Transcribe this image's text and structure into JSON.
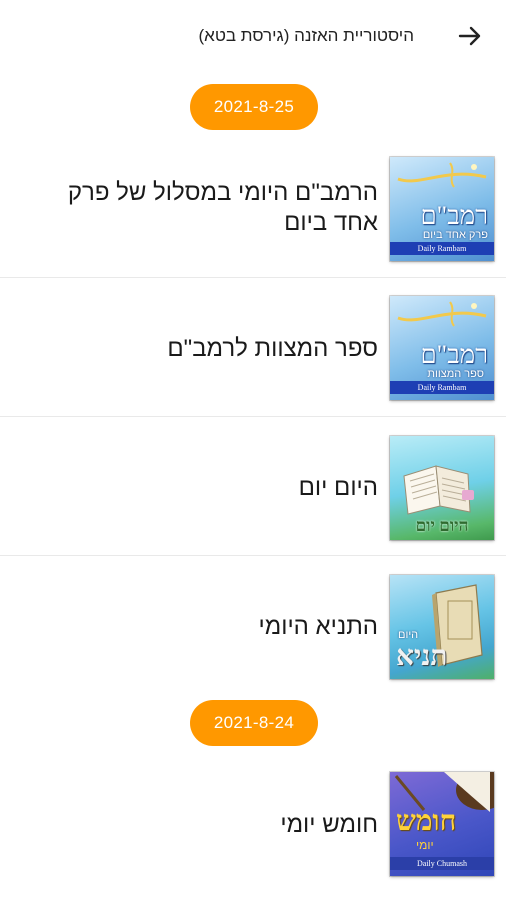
{
  "header": {
    "title": "היסטוריית האזנה (גירסת בטא)",
    "back_icon": "arrow-right-icon"
  },
  "colors": {
    "accent": "#ff9800",
    "divider": "#e9e9e9",
    "badge": "#1e3fb4"
  },
  "groups": [
    {
      "date": "2021-8-25",
      "items": [
        {
          "title": "הרמב\"ם היומי במסלול של פרק אחד ביום",
          "thumb_title": "רמב\"ם",
          "thumb_subtitle": "פרק אחד ביום",
          "badge": "Daily Rambam"
        },
        {
          "title": "ספר המצוות לרמב\"ם",
          "thumb_title": "רמב\"ם",
          "thumb_subtitle": "ספר המצוות",
          "badge": "Daily Rambam"
        },
        {
          "title": "היום יום",
          "thumb_title": "היום יום"
        },
        {
          "title": "התניא היומי",
          "thumb_small": "היום",
          "thumb_title": "תניא"
        }
      ]
    },
    {
      "date": "2021-8-24",
      "items": [
        {
          "title": "חומש יומי",
          "thumb_title": "חומש",
          "thumb_small": "יומי",
          "badge": "Daily Chumash"
        }
      ]
    }
  ]
}
